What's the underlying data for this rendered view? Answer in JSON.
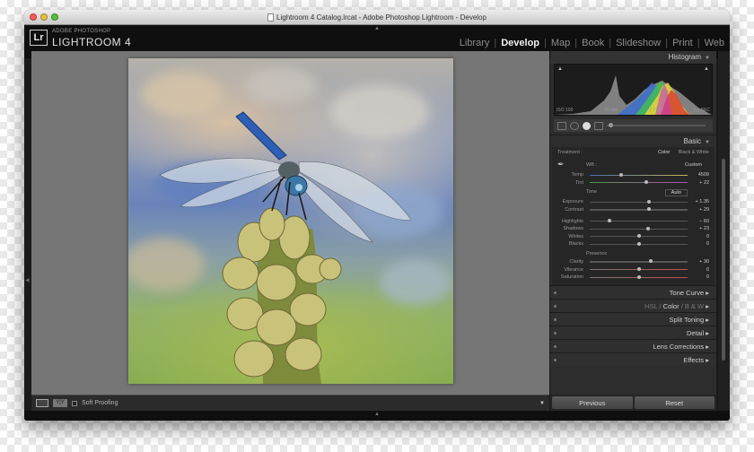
{
  "window": {
    "title": "Lightroom 4 Catalog.lrcat - Adobe Photoshop Lightroom - Develop"
  },
  "branding": {
    "logo": "Lr",
    "line1": "ADOBE PHOTOSHOP",
    "line2": "LIGHTROOM 4"
  },
  "modules": [
    "Library",
    "Develop",
    "Map",
    "Book",
    "Slideshow",
    "Print",
    "Web"
  ],
  "active_module": "Develop",
  "toolbar": {
    "soft_proofing_label": "Soft Proofing",
    "yy_label": "Y|Y"
  },
  "panels": {
    "histogram": {
      "title": "Histogram",
      "iso": "ISO 100",
      "focal": "35 mm",
      "aperture": "ƒ / 9.0",
      "shutter": "¹⁄₅₀ SEC"
    },
    "basic": {
      "title": "Basic",
      "treatment_label": "Treatment :",
      "treatment_options": [
        "Color",
        "Black & White"
      ],
      "wb_label": "WB :",
      "wb_value": "Custom",
      "temp": {
        "label": "Temp",
        "value": "4509",
        "pos": 0.32
      },
      "tint": {
        "label": "Tint",
        "value": "+ 22",
        "pos": 0.58
      },
      "tone_label": "Tone",
      "auto_label": "Auto",
      "exposure": {
        "label": "Exposure",
        "value": "+ 1.35",
        "pos": 0.61
      },
      "contrast": {
        "label": "Contrast",
        "value": "+ 29",
        "pos": 0.61
      },
      "highlights": {
        "label": "Highlights",
        "value": "− 60",
        "pos": 0.2
      },
      "shadows": {
        "label": "Shadows",
        "value": "+ 23",
        "pos": 0.6
      },
      "whites": {
        "label": "Whites",
        "value": "0",
        "pos": 0.5
      },
      "blacks": {
        "label": "Blacks",
        "value": "0",
        "pos": 0.5
      },
      "presence_label": "Presence",
      "clarity": {
        "label": "Clarity",
        "value": "+ 30",
        "pos": 0.62
      },
      "vibrance": {
        "label": "Vibrance",
        "value": "0",
        "pos": 0.5
      },
      "saturation": {
        "label": "Saturation",
        "value": "0",
        "pos": 0.5
      }
    },
    "collapsed": [
      "Tone Curve",
      "HSL / Color / B & W",
      "Split Toning",
      "Detail",
      "Lens Corrections",
      "Effects"
    ],
    "hsl_parts": [
      "HSL",
      "Color",
      "B & W"
    ]
  },
  "buttons": {
    "previous": "Previous",
    "reset": "Reset"
  }
}
